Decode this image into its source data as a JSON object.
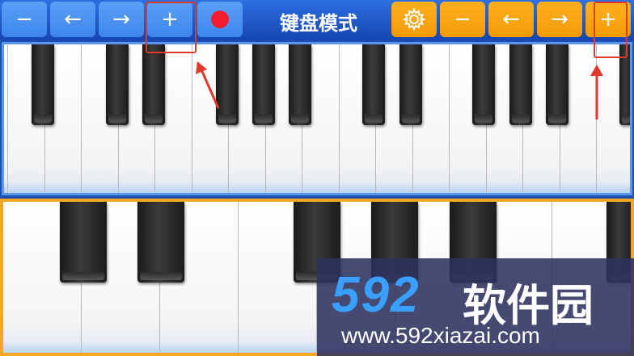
{
  "toolbar": {
    "left_buttons": [
      {
        "name": "zoom-out-button-top",
        "label": "−",
        "icon": "minus-icon"
      },
      {
        "name": "scroll-left-button-top",
        "label": "←",
        "icon": "arrow-left-icon"
      },
      {
        "name": "scroll-right-button-top",
        "label": "→",
        "icon": "arrow-right-icon"
      },
      {
        "name": "zoom-in-button-top",
        "label": "+",
        "icon": "plus-icon"
      }
    ],
    "record_icon": "record-icon",
    "title": "键盘模式",
    "settings_icon": "gear-icon",
    "right_buttons": [
      {
        "name": "zoom-out-button-bottom",
        "label": "−",
        "icon": "minus-icon"
      },
      {
        "name": "scroll-left-button-bottom",
        "label": "←",
        "icon": "arrow-left-icon"
      },
      {
        "name": "scroll-right-button-bottom",
        "label": "→",
        "icon": "arrow-right-icon"
      },
      {
        "name": "zoom-in-button-bottom",
        "label": "+",
        "icon": "plus-icon"
      }
    ]
  },
  "keyboard_top": {
    "white_key_count": 17,
    "black_key_count": 12
  },
  "keyboard_bottom": {
    "white_key_count": 8,
    "black_key_count": 6
  },
  "watermark": {
    "number": "592",
    "name": "软件园",
    "url": "www.592xiazai.com"
  },
  "colors": {
    "toolbar_blue": "#3e86ee",
    "toolbar_orange": "#f59a06",
    "record_red": "#f01d2c",
    "annotation_red": "#e0392b",
    "bottom_keyboard_border": "#f5a623"
  }
}
